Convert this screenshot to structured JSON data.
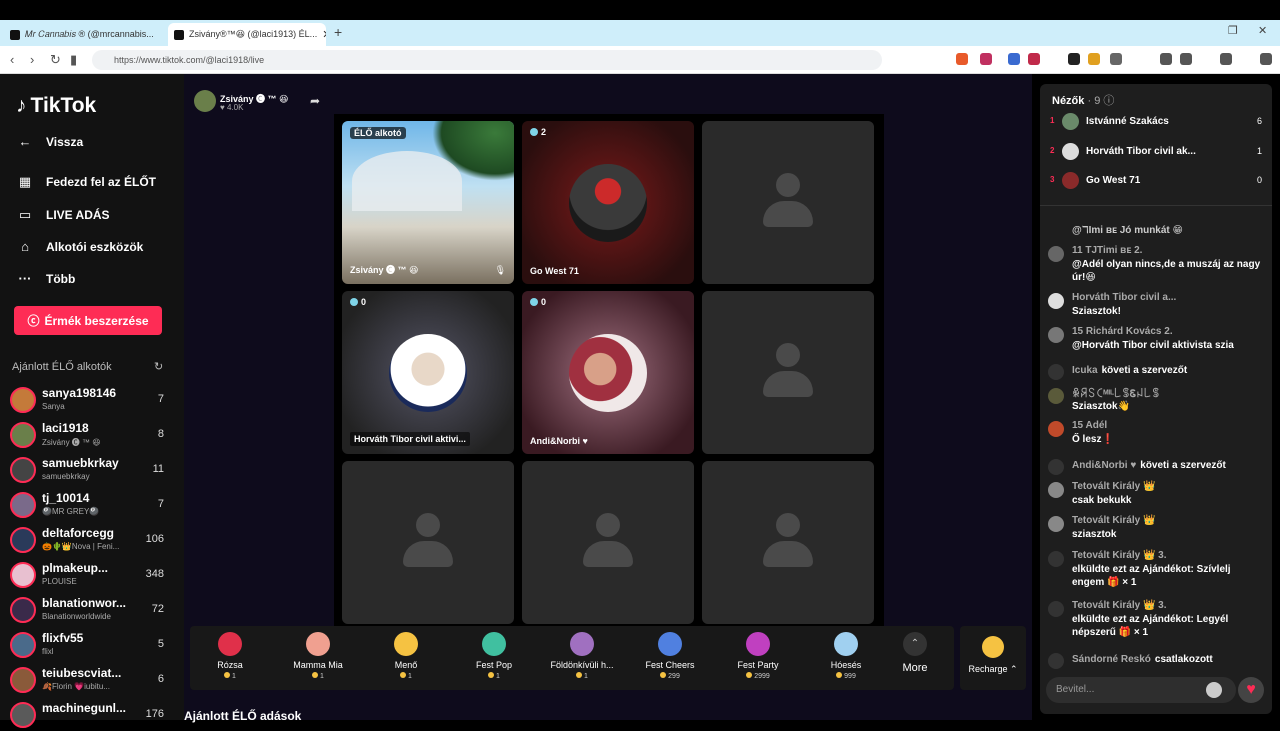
{
  "browser": {
    "tabs": [
      {
        "title": "𝑀𝑟 𝐶𝑎𝑛𝑛𝑎𝑏𝑖𝑠 ® (@mrcannabis..."
      },
      {
        "title": "Zsivány®™😆 (@laci1913) ÉL..."
      }
    ],
    "url": "https://www.tiktok.com/@laci1918/live"
  },
  "sidebar": {
    "logo": "TikTok",
    "nav": [
      {
        "label": "Vissza",
        "icon": "back-arrow-icon"
      },
      {
        "label": "Fedezd fel az ÉLŐT",
        "icon": "explore-live-icon"
      },
      {
        "label": "LIVE ADÁS",
        "icon": "video-camera-icon"
      },
      {
        "label": "Alkotói eszközök",
        "icon": "creator-tools-icon"
      },
      {
        "label": "Több",
        "icon": "more-icon"
      }
    ],
    "coin_button": "Érmék beszerzése",
    "recommended_title": "Ajánlott ÉLŐ alkotók",
    "creators": [
      {
        "name": "sanya198146",
        "sub": "Sanya",
        "count": "7",
        "color": "#c47a3a"
      },
      {
        "name": "laci1918",
        "sub": "Zsivány 🅒 ™ 😆",
        "count": "8",
        "color": "#6a7f4a"
      },
      {
        "name": "samuebkrkay",
        "sub": "samuebkrkay",
        "count": "11",
        "color": "#444444"
      },
      {
        "name": "tj_10014",
        "sub": "🎱MR GREY🎱",
        "count": "7",
        "color": "#7a6a8a"
      },
      {
        "name": "deltaforcegg",
        "sub": "🎃🌵👑Nova | Feni...",
        "count": "106",
        "color": "#2a3a5a"
      },
      {
        "name": "plmakeup...",
        "sub": "PLOUISE",
        "count": "348",
        "color": "#e8c0d0"
      },
      {
        "name": "blanationwor...",
        "sub": "Blanationworldwide",
        "count": "72",
        "color": "#3a2a4a"
      },
      {
        "name": "flixfv55",
        "sub": "flixl",
        "count": "5",
        "color": "#4a6a8a"
      },
      {
        "name": "teiubescviat...",
        "sub": "🍂Florin 💗iubitu...",
        "count": "6",
        "color": "#8a5a3a"
      },
      {
        "name": "machinegunl...",
        "sub": "",
        "count": "176",
        "color": "#5a5a5a"
      }
    ]
  },
  "main": {
    "host_name": "Zsivány 🅒 ™ 😆",
    "host_likes": "♥ 4.0K",
    "tiles": [
      {
        "label": "Zsivány 🅒 ™ 😆",
        "badge": "ÉLŐ alkotó"
      },
      {
        "label": "Go West 71",
        "viewers": "2"
      },
      {
        "label": "Horváth Tibor civil aktivi...",
        "viewers": "0"
      },
      {
        "label": "Andi&Norbi ♥",
        "viewers": "0"
      }
    ],
    "gifts": [
      {
        "name": "Rózsa",
        "price": "1",
        "color": "#e0304a"
      },
      {
        "name": "Mamma Mia",
        "price": "1",
        "color": "#f0a090"
      },
      {
        "name": "Menő",
        "price": "1",
        "color": "#f5c242"
      },
      {
        "name": "Fest Pop",
        "price": "1",
        "color": "#40c0a0"
      },
      {
        "name": "Földönkívüli h...",
        "price": "1",
        "color": "#a070c0"
      },
      {
        "name": "Fest Cheers",
        "price": "299",
        "color": "#5080e0"
      },
      {
        "name": "Fest Party",
        "price": "2999",
        "color": "#c040c0"
      },
      {
        "name": "Hóesés",
        "price": "999",
        "color": "#a0d0f0"
      }
    ],
    "more_label": "More",
    "recharge_label": "Recharge ⌃",
    "recommended_lives": "Ajánlott ÉLŐ adások"
  },
  "chat": {
    "viewers_title": "Nézők",
    "viewers_count": "· 9 ⓘ",
    "top_viewers": [
      {
        "rank": "1",
        "name": "Istvánné Szakács",
        "count": "6"
      },
      {
        "rank": "2",
        "name": "Horváth Tibor civil ak...",
        "count": "1"
      },
      {
        "rank": "3",
        "name": "Go West 71",
        "count": "0"
      }
    ],
    "messages": [
      {
        "user": "",
        "text": "@ℸImi ʙᴇ Jó munkát 😁"
      },
      {
        "user": "11 TJTimi ʙᴇ 2.",
        "text": "@Adél olyan nincs,de a muszáj az nagy úr!😆"
      },
      {
        "user": "Horváth Tibor civil a...",
        "text": "Sziasztok!"
      },
      {
        "user": "15 Richárd Kovács 2.",
        "text": "@Horváth Tibor civil aktivista szia"
      },
      {
        "user": "Icuka",
        "text": "követi a szervezőt"
      },
      {
        "user": "ꆜꋪꇙꉔᴹᴵᴸ꒒ꌚᏋꈤ꒒ꌚ",
        "text": "Sziasztok👋"
      },
      {
        "user": "15 Adél",
        "text": "Ő lesz❗"
      },
      {
        "user": "Andi&Norbi ♥",
        "text": "követi a szervezőt"
      },
      {
        "user": "Tetovált Király 👑",
        "text": "csak bekukk"
      },
      {
        "user": "Tetovált Király 👑",
        "text": "sziasztok"
      },
      {
        "user": "Tetovált Király 👑 3.",
        "text": "elküldte ezt az Ajándékot: Szívlelj engem 🎁 × 1"
      },
      {
        "user": "Tetovált Király 👑 3.",
        "text": "elküldte ezt az Ajándékot: Legyél népszerű 🎁 × 1"
      },
      {
        "user": "Sándorné Reskó",
        "text": "csatlakozott"
      }
    ],
    "input_placeholder": "Bevitel..."
  }
}
